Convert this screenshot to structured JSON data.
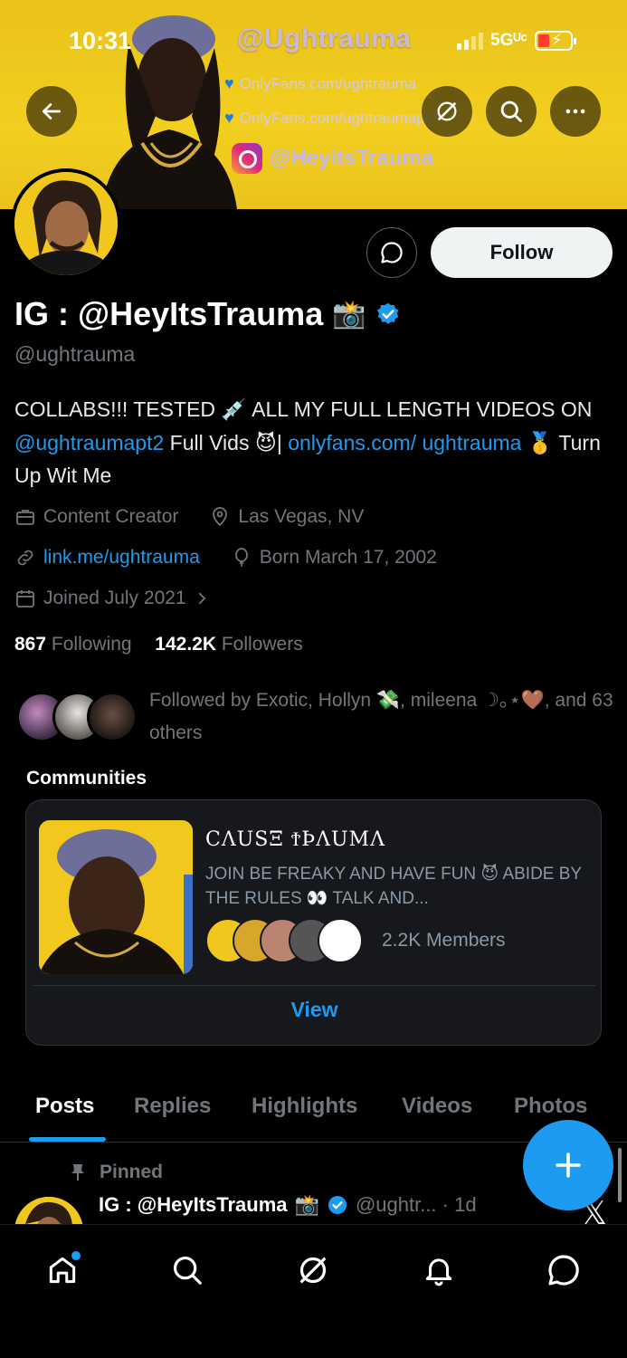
{
  "status_bar": {
    "time": "10:31",
    "network": "5Gᵁᶜ",
    "battery_state": "low-charging"
  },
  "banner": {
    "handle_text": "@Ughtrauma",
    "line1": "OnlyFans.com/ughtrauma",
    "line2": "OnlyFans.com/ughtraumapt2",
    "instagram": "@HeyitsTrauma"
  },
  "header_actions": {
    "back_icon": "arrow-left-icon",
    "grok_icon": "grok-icon",
    "search_icon": "search-icon",
    "more_icon": "more-horizontal-icon"
  },
  "profile": {
    "display_name": "IG : @HeyItsTrauma",
    "name_emoji": "📸",
    "handle": "@ughtrauma",
    "follow_label": "Follow",
    "bio_part1": "COLLABS!!! TESTED 💉 ALL MY FULL LENGTH VIDEOS ON ",
    "bio_mention": "@ughtraumapt2",
    "bio_part2": " Full Vids 😈| ",
    "bio_link": "onlyfans.com/ ughtrauma",
    "bio_part3": " 🥇 Turn Up Wit Me",
    "category": "Content Creator",
    "location": "Las Vegas, NV",
    "website": "link.me/ughtrauma",
    "born": "Born March 17, 2002",
    "joined": "Joined July 2021",
    "following_count": "867",
    "following_label": "Following",
    "followers_count": "142.2K",
    "followers_label": "Followers",
    "followed_by": "Followed by Exotic, Hollyn 💸, mileena ☽｡⋆🤎, and 63 others"
  },
  "communities": {
    "title": "Communities",
    "name": "ᑕᖇᑌᔕᗴ ✝ᖇᗩᑌᗰᗩ",
    "name_text": "ϹΛUSΞ ϮϷΛUMΛ",
    "description": "JOIN BE FREAKY AND HAVE FUN 😈 ABIDE BY THE RULES 👀 TALK AND...",
    "members": "2.2K Members",
    "view_label": "View"
  },
  "tabs": [
    {
      "label": "Posts",
      "active": true
    },
    {
      "label": "Replies",
      "active": false
    },
    {
      "label": "Highlights",
      "active": false
    },
    {
      "label": "Videos",
      "active": false
    },
    {
      "label": "Photos",
      "active": false
    }
  ],
  "pinned_post": {
    "pinned_label": "Pinned",
    "author": "IG : @HeyItsTrauma",
    "author_emoji": "📸",
    "handle_time": "@ughtr... · 1d"
  },
  "bottom_nav": [
    "home-icon",
    "search-icon",
    "grok-icon",
    "bell-icon",
    "messages-icon"
  ],
  "colors": {
    "accent": "#1d9bf0",
    "banner": "#f2cf1f",
    "background": "#000000",
    "muted": "#71767b"
  }
}
